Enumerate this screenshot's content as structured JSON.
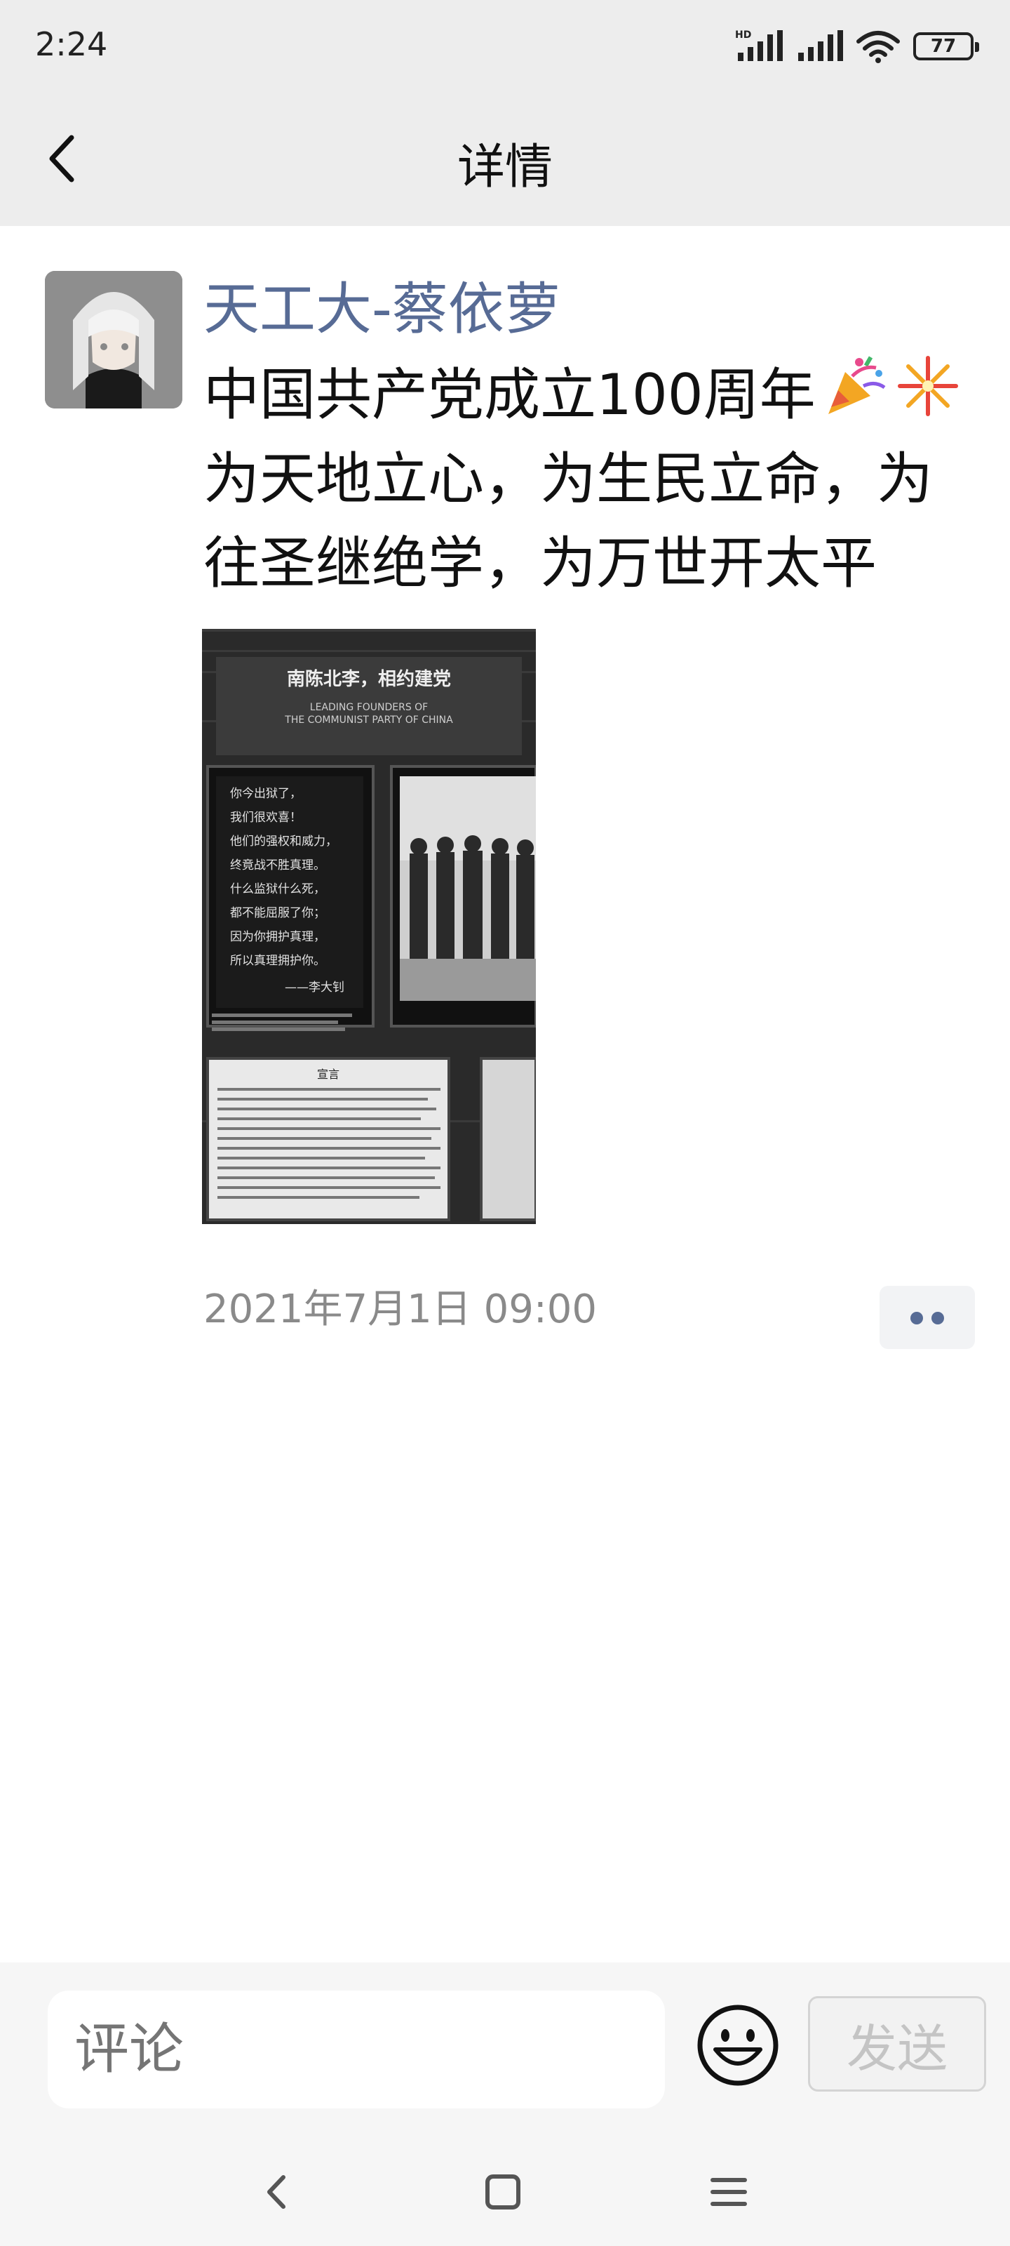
{
  "status_bar": {
    "time": "2:24",
    "network_label": "HD",
    "battery": "77"
  },
  "header": {
    "back_icon": "chevron-left-icon",
    "title": "详情"
  },
  "post": {
    "author": "天工大-蔡依萝",
    "text_lines": [
      "中国共产党成立100周年",
      "为天地立心，为生民立命，为",
      "往圣继绝学，为万世开太平"
    ],
    "emojis": [
      "party-popper-icon",
      "fireworks-icon"
    ],
    "photo": {
      "sign_title": "南陈北李，相约建党",
      "sign_subtitle_1": "LEADING FOUNDERS OF",
      "sign_subtitle_2": "THE COMMUNIST PARTY OF CHINA",
      "poem": [
        "你今出狱了，",
        "我们很欢喜！",
        "他们的强权和威力，",
        "终竟战不胜真理。",
        "什么监狱什么死，",
        "都不能屈服了你；",
        "因为你拥护真理，",
        "所以真理拥护你。",
        "——李大钊"
      ],
      "newspaper_title": "宣言"
    },
    "timestamp": "2021年7月1日 09:00",
    "more_icon": "two-dots-icon"
  },
  "comment_bar": {
    "placeholder": "评论",
    "emoji_icon": "smiley-icon",
    "send_label": "发送"
  },
  "system_nav": {
    "back": "triangle-back-icon",
    "home": "square-home-icon",
    "menu": "menu-lines-icon"
  },
  "colors": {
    "link_blue": "#576b95",
    "background": "#ededed"
  }
}
